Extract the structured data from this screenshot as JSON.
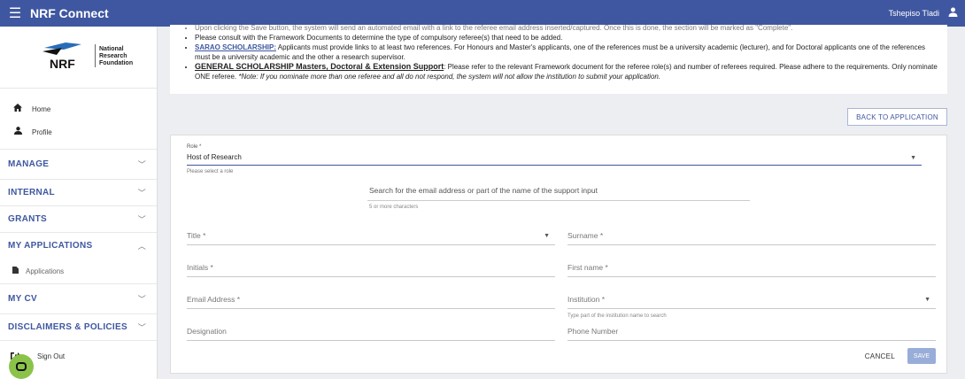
{
  "topbar": {
    "title": "NRF Connect",
    "user_name": "Tshepiso Tladi"
  },
  "sidebar": {
    "logo": {
      "mark": "NRF",
      "line1": "National",
      "line2": "Research",
      "line3": "Foundation"
    },
    "home": "Home",
    "profile": "Profile",
    "sections": {
      "manage": "MANAGE",
      "internal": "INTERNAL",
      "grants": "GRANTS",
      "my_applications": "MY APPLICATIONS",
      "my_cv": "MY CV",
      "disclaimers": "DISCLAIMERS & POLICIES"
    },
    "applications": "Applications",
    "sign_out": "Sign Out"
  },
  "notes": {
    "cut_line": "Upon clicking the Save button, the system will send an automated email with a link to the referee email address inserted/captured. Once this is done, the section will be marked as \"Complete\".",
    "consult": "Please consult with the Framework Documents to determine the type of compulsory referee(s) that need to be added.",
    "sarao_title": "SARAO SCHOLARSHIP:",
    "sarao_text": " Applicants must provide links to at least two references. For Honours and Master's applicants, one of the references must be a university academic (lecturer), and for Doctoral applicants one of the references must be a university academic and the other a research supervisor.",
    "general_title": "GENERAL SCHOLARSHIP Masters, Doctoral & Extension Support",
    "general_text": ": Please refer to the relevant Framework document for the referee role(s) and number of referees required. Please adhere to the requirements. Only nominate ONE referee. ",
    "general_note": "*Note: If you nominate more than one referee and all do not respond, the system will not allow the institution to submit your application."
  },
  "back_button": "BACK TO APPLICATION",
  "form": {
    "role_label": "Role *",
    "role_value": "Host of Research",
    "role_hint": "Please select a role",
    "search_label": "Search for the email address or part of the name of the support input",
    "search_hint": "5 or more characters",
    "title": "Title *",
    "surname": "Surname *",
    "initials": "Initials *",
    "first_name": "First name *",
    "email": "Email Address *",
    "institution": "Institution *",
    "institution_hint": "Type part of the institution name to search",
    "designation": "Designation",
    "phone": "Phone Number",
    "cancel": "CANCEL",
    "save": "SAVE"
  },
  "colors": {
    "brand": "#3f57a0",
    "chat": "#8bc34a",
    "save_disabled": "#98add8"
  },
  "icons": [
    "menu-icon",
    "user-icon",
    "home-icon",
    "profile-icon",
    "chevron-down-icon",
    "chevron-up-icon",
    "applications-icon",
    "sign-out-icon",
    "chat-icon",
    "caret-down-icon"
  ]
}
